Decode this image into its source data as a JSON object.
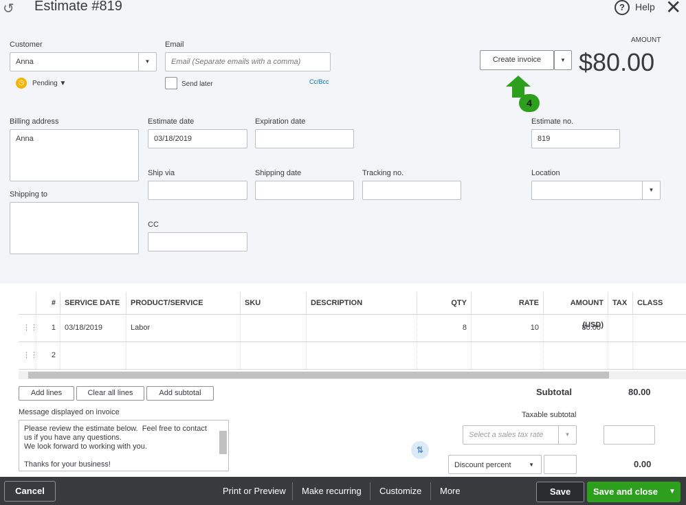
{
  "header": {
    "title": "Estimate #819",
    "help": "Help",
    "history_icon": "history-clock-icon",
    "close_icon": "close-x-icon"
  },
  "customer": {
    "label": "Customer",
    "value": "Anna",
    "status": "Pending"
  },
  "email": {
    "label": "Email",
    "placeholder": "Email (Separate emails with a comma)",
    "send_later": "Send later",
    "send_later_checked": false,
    "cc_bcc": "Cc/Bcc"
  },
  "actions": {
    "create_invoice": "Create invoice",
    "annotation_number": "4",
    "annotation_color": "#2ca01c"
  },
  "amount": {
    "label": "AMOUNT",
    "value": "$80.00"
  },
  "billing": {
    "label": "Billing address",
    "value": "Anna"
  },
  "shipping_to": {
    "label": "Shipping to",
    "value": ""
  },
  "estimate_date": {
    "label": "Estimate date",
    "value": "03/18/2019"
  },
  "expiration_date": {
    "label": "Expiration date",
    "value": ""
  },
  "estimate_no": {
    "label": "Estimate no.",
    "value": "819"
  },
  "ship_via": {
    "label": "Ship via",
    "value": ""
  },
  "shipping_date": {
    "label": "Shipping date",
    "value": ""
  },
  "tracking_no": {
    "label": "Tracking no.",
    "value": ""
  },
  "location": {
    "label": "Location",
    "value": ""
  },
  "cc": {
    "label": "CC",
    "value": ""
  },
  "table": {
    "columns": [
      "#",
      "SERVICE DATE",
      "PRODUCT/SERVICE",
      "SKU",
      "DESCRIPTION",
      "QTY",
      "RATE",
      "AMOUNT (USD)",
      "TAX",
      "CLASS"
    ],
    "rows": [
      {
        "n": "1",
        "service_date": "03/18/2019",
        "product": "Labor",
        "sku": "",
        "description": "",
        "qty": "8",
        "rate": "10",
        "amount": "80.00"
      },
      {
        "n": "2",
        "service_date": "",
        "product": "",
        "sku": "",
        "description": "",
        "qty": "",
        "rate": "",
        "amount": ""
      }
    ]
  },
  "table_buttons": {
    "add_lines": "Add lines",
    "clear_all": "Clear all lines",
    "add_subtotal": "Add subtotal"
  },
  "message": {
    "label": "Message displayed on invoice",
    "value": "Please review the estimate below.  Feel free to contact us if you have any questions.\nWe look forward to working with you.\n\nThanks for your business!"
  },
  "totals": {
    "subtotal_label": "Subtotal",
    "subtotal": "80.00",
    "taxable_label": "Taxable subtotal",
    "tax_placeholder": "Select a sales tax rate",
    "discount_type": "Discount percent",
    "discount_value": "0.00"
  },
  "footer": {
    "cancel": "Cancel",
    "print": "Print or Preview",
    "recurring": "Make recurring",
    "customize": "Customize",
    "more": "More",
    "save": "Save",
    "save_close": "Save and close",
    "green": "#2ca01c",
    "bg": "#393a3d"
  }
}
